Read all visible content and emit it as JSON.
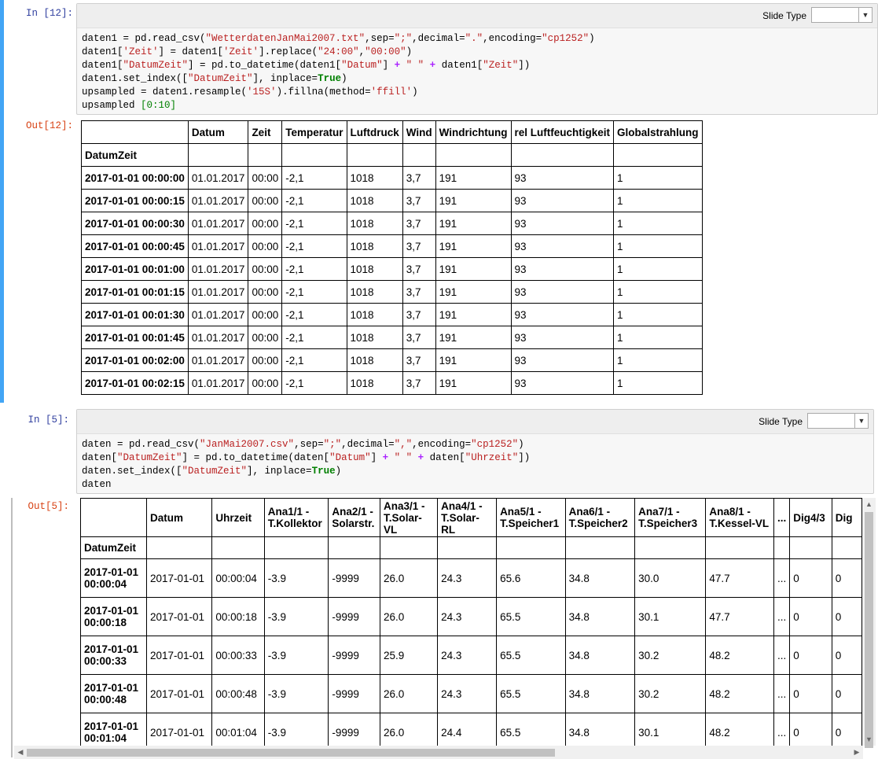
{
  "cell1": {
    "in_prompt": "In [12]:",
    "out_prompt": "Out[12]:",
    "slide_label": "Slide Type",
    "code_lines": [
      {
        "parts": [
          [
            "",
            "daten1 = pd.read_csv("
          ],
          [
            "str",
            "\"WetterdatenJanMai2007.txt\""
          ],
          [
            "",
            ",sep="
          ],
          [
            "str",
            "\";\""
          ],
          [
            "",
            ",decimal="
          ],
          [
            "str",
            "\".\""
          ],
          [
            "",
            ",encoding="
          ],
          [
            "str",
            "\"cp1252\""
          ],
          [
            "",
            ")"
          ]
        ]
      },
      {
        "parts": [
          [
            "",
            "daten1["
          ],
          [
            "str",
            "'Zeit'"
          ],
          [
            "",
            "] = daten1["
          ],
          [
            "str",
            "'Zeit'"
          ],
          [
            "",
            "].replace("
          ],
          [
            "str",
            "\"24:00\""
          ],
          [
            "",
            ","
          ],
          [
            "str",
            "\"00:00\""
          ],
          [
            "",
            ")"
          ]
        ]
      },
      {
        "parts": [
          [
            "",
            "daten1["
          ],
          [
            "str",
            "\"DatumZeit\""
          ],
          [
            "",
            "] = pd.to_datetime(daten1["
          ],
          [
            "str",
            "\"Datum\""
          ],
          [
            "",
            "] "
          ],
          [
            "op",
            "+"
          ],
          [
            "",
            " "
          ],
          [
            "str",
            "\" \""
          ],
          [
            "",
            " "
          ],
          [
            "op",
            "+"
          ],
          [
            "",
            " daten1["
          ],
          [
            "str",
            "\"Zeit\""
          ],
          [
            "",
            "])"
          ]
        ]
      },
      {
        "parts": [
          [
            "",
            "daten1.set_index(["
          ],
          [
            "str",
            "\"DatumZeit\""
          ],
          [
            "",
            "], inplace="
          ],
          [
            "kw",
            "True"
          ],
          [
            "",
            ")"
          ]
        ]
      },
      {
        "parts": [
          [
            "",
            "upsampled = daten1.resample("
          ],
          [
            "str",
            "'15S'"
          ],
          [
            "",
            ").fillna(method="
          ],
          [
            "str",
            "'ffill'"
          ],
          [
            "",
            ")"
          ]
        ]
      },
      {
        "parts": [
          [
            "",
            "upsampled "
          ],
          [
            "num",
            "[0:10]"
          ]
        ]
      }
    ],
    "table": {
      "columns": [
        "Datum",
        "Zeit",
        "Temperatur",
        "Luftdruck",
        "Wind",
        "Windrichtung",
        "rel Luftfeuchtigkeit",
        "Globalstrahlung"
      ],
      "index_name": "DatumZeit",
      "rows": [
        {
          "index": "2017-01-01 00:00:00",
          "values": [
            "01.01.2017",
            "00:00",
            "-2,1",
            "1018",
            "3,7",
            "191",
            "93",
            "1"
          ]
        },
        {
          "index": "2017-01-01 00:00:15",
          "values": [
            "01.01.2017",
            "00:00",
            "-2,1",
            "1018",
            "3,7",
            "191",
            "93",
            "1"
          ]
        },
        {
          "index": "2017-01-01 00:00:30",
          "values": [
            "01.01.2017",
            "00:00",
            "-2,1",
            "1018",
            "3,7",
            "191",
            "93",
            "1"
          ]
        },
        {
          "index": "2017-01-01 00:00:45",
          "values": [
            "01.01.2017",
            "00:00",
            "-2,1",
            "1018",
            "3,7",
            "191",
            "93",
            "1"
          ]
        },
        {
          "index": "2017-01-01 00:01:00",
          "values": [
            "01.01.2017",
            "00:00",
            "-2,1",
            "1018",
            "3,7",
            "191",
            "93",
            "1"
          ]
        },
        {
          "index": "2017-01-01 00:01:15",
          "values": [
            "01.01.2017",
            "00:00",
            "-2,1",
            "1018",
            "3,7",
            "191",
            "93",
            "1"
          ]
        },
        {
          "index": "2017-01-01 00:01:30",
          "values": [
            "01.01.2017",
            "00:00",
            "-2,1",
            "1018",
            "3,7",
            "191",
            "93",
            "1"
          ]
        },
        {
          "index": "2017-01-01 00:01:45",
          "values": [
            "01.01.2017",
            "00:00",
            "-2,1",
            "1018",
            "3,7",
            "191",
            "93",
            "1"
          ]
        },
        {
          "index": "2017-01-01 00:02:00",
          "values": [
            "01.01.2017",
            "00:00",
            "-2,1",
            "1018",
            "3,7",
            "191",
            "93",
            "1"
          ]
        },
        {
          "index": "2017-01-01 00:02:15",
          "values": [
            "01.01.2017",
            "00:00",
            "-2,1",
            "1018",
            "3,7",
            "191",
            "93",
            "1"
          ]
        }
      ]
    }
  },
  "cell2": {
    "in_prompt": "In [5]:",
    "out_prompt": "Out[5]:",
    "slide_label": "Slide Type",
    "code_lines": [
      {
        "parts": [
          [
            "",
            "daten = pd.read_csv("
          ],
          [
            "str",
            "\"JanMai2007.csv\""
          ],
          [
            "",
            ",sep="
          ],
          [
            "str",
            "\";\""
          ],
          [
            "",
            ",decimal="
          ],
          [
            "str",
            "\",\""
          ],
          [
            "",
            ",encoding="
          ],
          [
            "str",
            "\"cp1252\""
          ],
          [
            "",
            ")"
          ]
        ]
      },
      {
        "parts": [
          [
            "",
            "daten["
          ],
          [
            "str",
            "\"DatumZeit\""
          ],
          [
            "",
            "] = pd.to_datetime(daten["
          ],
          [
            "str",
            "\"Datum\""
          ],
          [
            "",
            "] "
          ],
          [
            "op",
            "+"
          ],
          [
            "",
            " "
          ],
          [
            "str",
            "\" \""
          ],
          [
            "",
            " "
          ],
          [
            "op",
            "+"
          ],
          [
            "",
            " daten["
          ],
          [
            "str",
            "\"Uhrzeit\""
          ],
          [
            "",
            "])"
          ]
        ]
      },
      {
        "parts": [
          [
            "",
            "daten.set_index(["
          ],
          [
            "str",
            "\"DatumZeit\""
          ],
          [
            "",
            "], inplace="
          ],
          [
            "kw",
            "True"
          ],
          [
            "",
            ")"
          ]
        ]
      },
      {
        "parts": [
          [
            "",
            "daten"
          ]
        ]
      }
    ],
    "table": {
      "columns": [
        "Datum",
        "Uhrzeit",
        "Ana1/1 - T.Kollektor",
        "Ana2/1 - Solarstr.",
        "Ana3/1 - T.Solar-VL",
        "Ana4/1 - T.Solar-RL",
        "Ana5/1 - T.Speicher1",
        "Ana6/1 - T.Speicher2",
        "Ana7/1 - T.Speicher3",
        "Ana8/1 - T.Kessel-VL",
        "...",
        "Dig4/3",
        "Dig"
      ],
      "index_name": "DatumZeit",
      "rows": [
        {
          "index": "2017-01-01 00:00:04",
          "values": [
            "2017-01-01",
            "00:00:04",
            "-3.9",
            "-9999",
            "26.0",
            "24.3",
            "65.6",
            "34.8",
            "30.0",
            "47.7",
            "...",
            "0",
            "0"
          ]
        },
        {
          "index": "2017-01-01 00:00:18",
          "values": [
            "2017-01-01",
            "00:00:18",
            "-3.9",
            "-9999",
            "26.0",
            "24.3",
            "65.5",
            "34.8",
            "30.1",
            "47.7",
            "...",
            "0",
            "0"
          ]
        },
        {
          "index": "2017-01-01 00:00:33",
          "values": [
            "2017-01-01",
            "00:00:33",
            "-3.9",
            "-9999",
            "25.9",
            "24.3",
            "65.5",
            "34.8",
            "30.2",
            "48.2",
            "...",
            "0",
            "0"
          ]
        },
        {
          "index": "2017-01-01 00:00:48",
          "values": [
            "2017-01-01",
            "00:00:48",
            "-3.9",
            "-9999",
            "26.0",
            "24.3",
            "65.5",
            "34.8",
            "30.2",
            "48.2",
            "...",
            "0",
            "0"
          ]
        },
        {
          "index": "2017-01-01 00:01:04",
          "values": [
            "2017-01-01",
            "00:01:04",
            "-3.9",
            "-9999",
            "26.0",
            "24.4",
            "65.5",
            "34.8",
            "30.1",
            "48.2",
            "...",
            "0",
            "0"
          ]
        }
      ]
    }
  }
}
